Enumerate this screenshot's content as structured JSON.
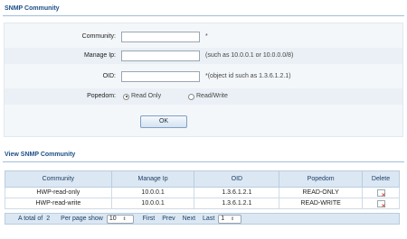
{
  "section1": {
    "title": "SNMP Community"
  },
  "form": {
    "community": {
      "label": "Community:",
      "value": "",
      "hint": "*"
    },
    "manage_ip": {
      "label": "Manage Ip:",
      "value": "",
      "hint": "(such as 10.0.0.1 or 10.0.0.0/8)"
    },
    "oid": {
      "label": "OID:",
      "value": "",
      "hint": "*(object id such as 1.3.6.1.2.1)"
    },
    "popedom": {
      "label": "Popedom:",
      "options": [
        "Read Only",
        "Read/Write"
      ],
      "selected": "Read Only"
    },
    "ok_label": "OK"
  },
  "section2": {
    "title": "View SNMP Community"
  },
  "table": {
    "headers": [
      "Community",
      "Manage Ip",
      "OID",
      "Popedom",
      "Delete"
    ],
    "rows": [
      {
        "community": "HWP-read-only",
        "manage_ip": "10.0.0.1",
        "oid": "1.3.6.1.2.1",
        "popedom": "READ-ONLY"
      },
      {
        "community": "HWP-read-write",
        "manage_ip": "10.0.0.1",
        "oid": "1.3.6.1.2.1",
        "popedom": "READ-WRITE"
      }
    ]
  },
  "pager": {
    "total_label": "A total of",
    "total": "2",
    "per_page_label": "Per page show",
    "per_page": "10",
    "first": "First",
    "prev": "Prev",
    "next": "Next",
    "last": "Last",
    "page": "1"
  },
  "colors": {
    "title": "#1c4f86",
    "header_bg": "#dbe7f2",
    "delete_icon": "#d21c1c"
  }
}
